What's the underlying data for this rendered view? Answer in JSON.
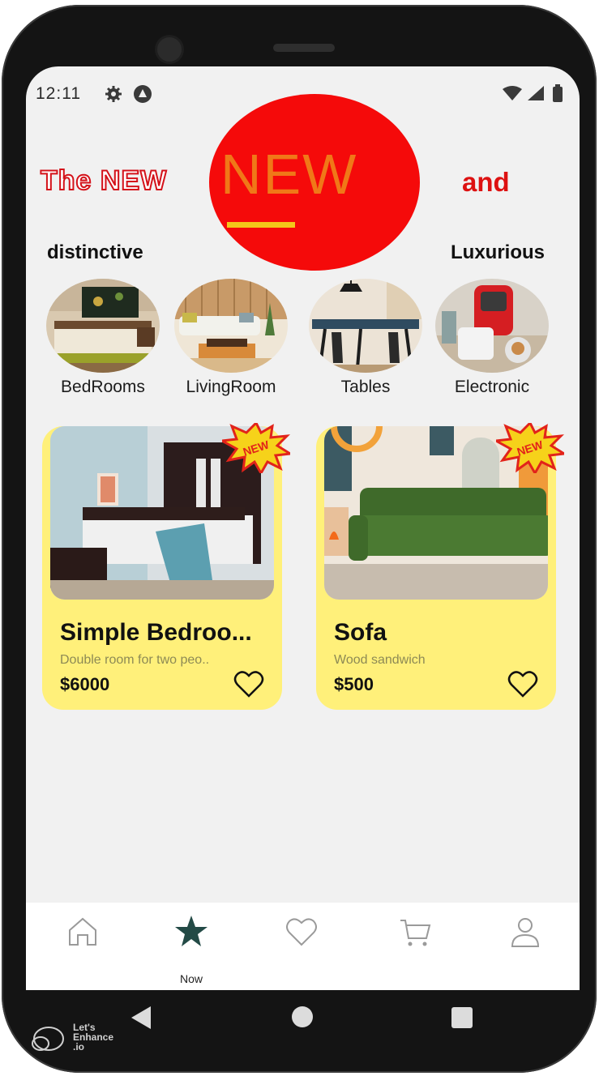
{
  "status_bar": {
    "time": "12:11",
    "left_icons": [
      "gear-icon",
      "alert-icon"
    ],
    "right_icons": [
      "wifi-icon",
      "signal-icon",
      "battery-icon"
    ]
  },
  "hero": {
    "left_text": "The NEW",
    "center_text": "NEW",
    "right_text": "and",
    "sub_left": "distinctive",
    "sub_right": "Luxurious",
    "circle_color": "#f50a0a"
  },
  "categories": [
    {
      "label": "BedRooms"
    },
    {
      "label": "LivingRoom"
    },
    {
      "label": "Tables"
    },
    {
      "label": "Electronic"
    }
  ],
  "products": [
    {
      "title": "Simple Bedroo...",
      "description": "Double room for two peo..",
      "price": "$6000",
      "badge": "NEW"
    },
    {
      "title": "Sofa",
      "description": "Wood sandwich",
      "price": "$500",
      "badge": "NEW"
    }
  ],
  "bottom_nav": {
    "items": [
      {
        "icon": "home-icon"
      },
      {
        "icon": "star-icon",
        "label": "Now"
      },
      {
        "icon": "heart-icon"
      },
      {
        "icon": "cart-icon"
      },
      {
        "icon": "profile-icon"
      }
    ],
    "active_color": "#234a46"
  },
  "watermark": {
    "line1": "Let's",
    "line2": "Enhance",
    "line3": ".io"
  },
  "colors": {
    "card_bg": "#fff07a",
    "accent_red": "#dd1111",
    "screen_bg": "#f1f1f1"
  }
}
